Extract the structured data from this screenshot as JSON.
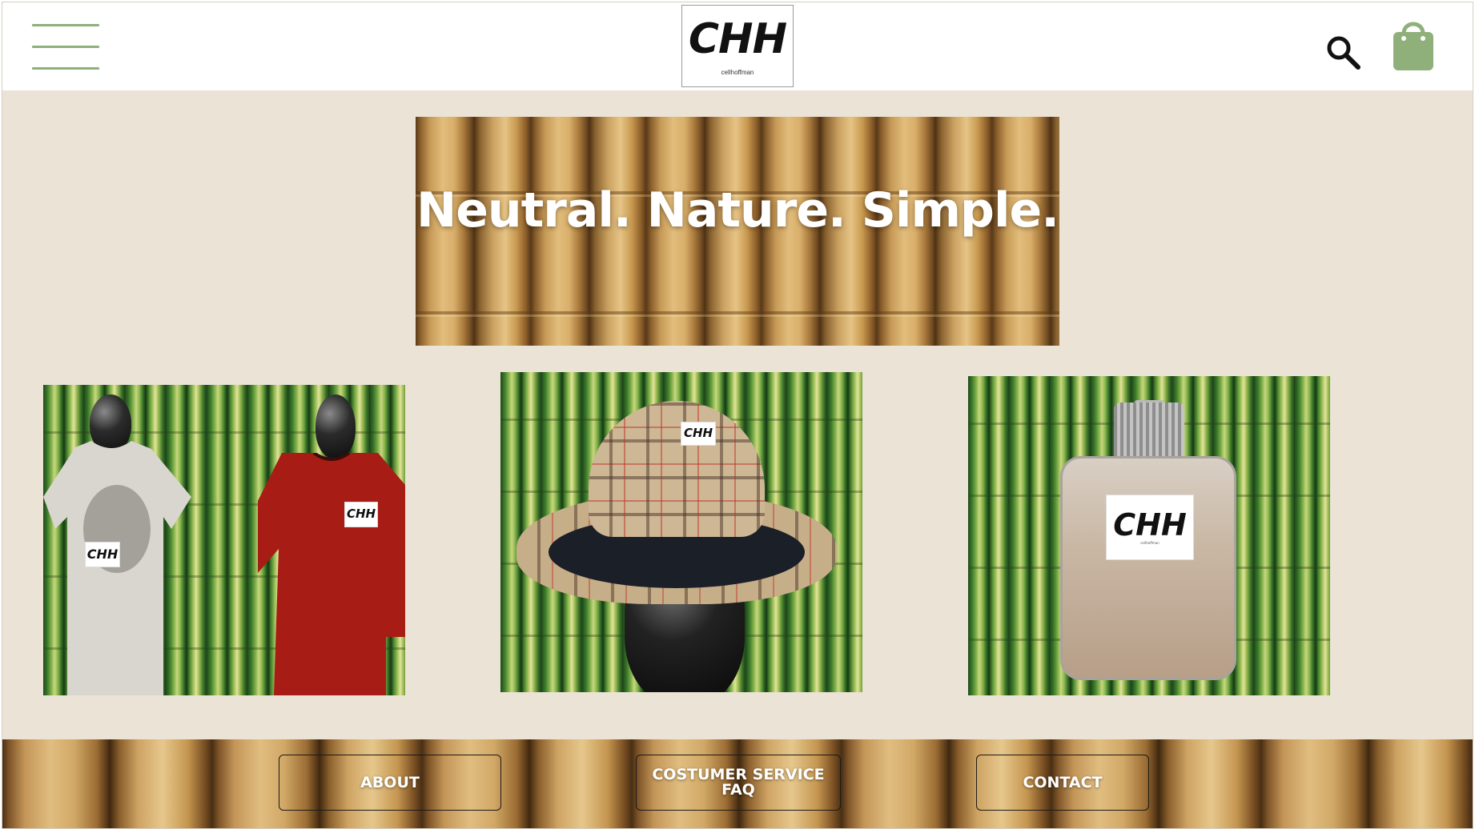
{
  "header": {
    "menu_icon": "hamburger-menu-icon",
    "logo": {
      "mark": "CHH",
      "subtitle": "cellhoffman"
    },
    "search_icon": "search-icon",
    "bag_icon": "shopping-bag-icon",
    "accent_color": "#8fb07a"
  },
  "hero": {
    "title": "Neutral. Nature. Simple."
  },
  "products": [
    {
      "label_mark_1": "CHH",
      "label_mark_2": "CHH",
      "kind": "t-shirts"
    },
    {
      "label_mark": "CHH",
      "kind": "bucket-hat"
    },
    {
      "label_mark": "CHH",
      "label_sub": "cellhoffman",
      "kind": "perfume"
    }
  ],
  "footer": {
    "about": "ABOUT",
    "service_line1": "COSTUMER SERVICE",
    "service_line2": "FAQ",
    "contact": "CONTACT"
  },
  "colors": {
    "page_background": "#ebe3d6",
    "header_background": "#ffffff",
    "icon_green": "#8fb07a"
  }
}
